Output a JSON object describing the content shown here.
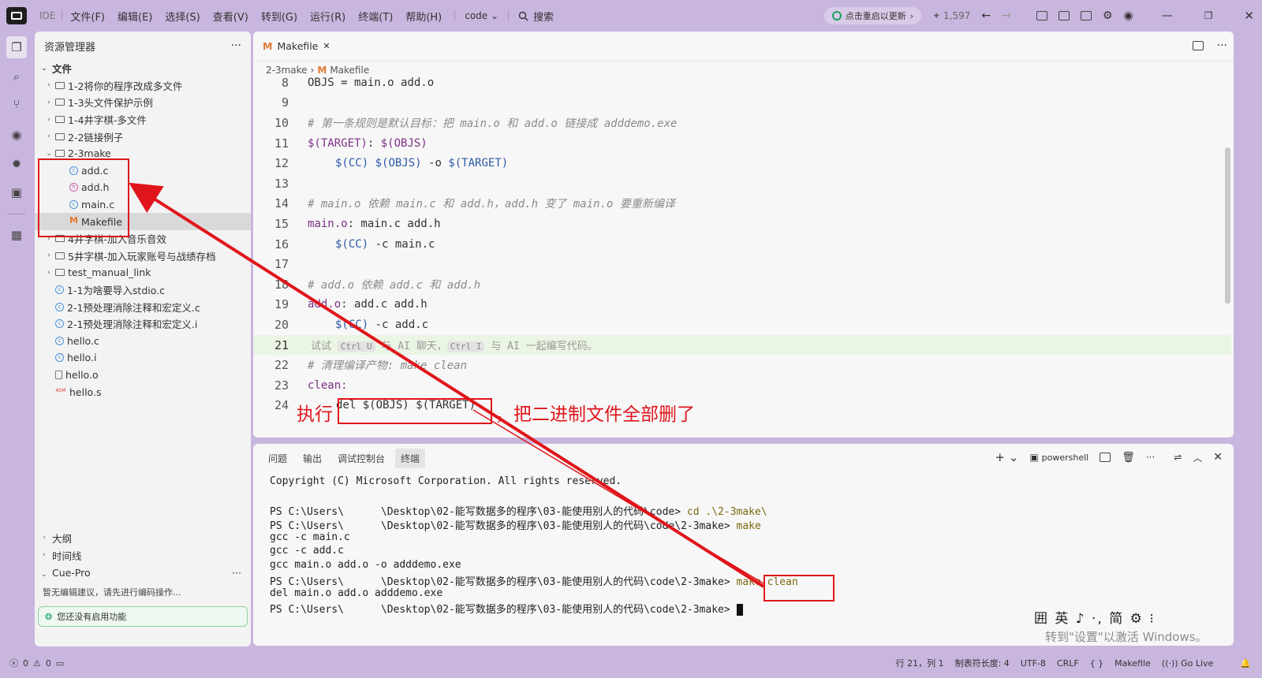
{
  "titlebar": {
    "ide_label": "IDE",
    "menus": [
      "文件(F)",
      "编辑(E)",
      "选择(S)",
      "查看(V)",
      "转到(G)",
      "运行(R)",
      "终端(T)",
      "帮助(H)"
    ],
    "workspace": "code",
    "search": "搜索",
    "update_label": "点击重启以更新",
    "count": "1,597"
  },
  "sidebar": {
    "title": "资源管理器",
    "root": "文件",
    "items": [
      {
        "label": "1-2将你的程序改成多文件",
        "type": "folder",
        "depth": 1
      },
      {
        "label": "1-3头文件保护示例",
        "type": "folder",
        "depth": 1
      },
      {
        "label": "1-4井字棋-多文件",
        "type": "folder",
        "depth": 1
      },
      {
        "label": "2-2链接例子",
        "type": "folder",
        "depth": 1
      },
      {
        "label": "2-3make",
        "type": "folder-open",
        "depth": 1
      },
      {
        "label": "add.c",
        "type": "c",
        "depth": 2
      },
      {
        "label": "add.h",
        "type": "h",
        "depth": 2
      },
      {
        "label": "main.c",
        "type": "c",
        "depth": 2
      },
      {
        "label": "Makefile",
        "type": "make",
        "depth": 2
      },
      {
        "label": "4井字棋-加入音乐音效",
        "type": "folder",
        "depth": 1
      },
      {
        "label": "5井字棋-加入玩家账号与战绩存档",
        "type": "folder",
        "depth": 1
      },
      {
        "label": "test_manual_link",
        "type": "folder",
        "depth": 1
      },
      {
        "label": "1-1为啥要导入stdio.c",
        "type": "c",
        "depth": 1
      },
      {
        "label": "2-1预处理消除注释和宏定义.c",
        "type": "c",
        "depth": 1
      },
      {
        "label": "2-1预处理消除注释和宏定义.i",
        "type": "c",
        "depth": 1
      },
      {
        "label": "hello.c",
        "type": "c",
        "depth": 1
      },
      {
        "label": "hello.i",
        "type": "c",
        "depth": 1
      },
      {
        "label": "hello.o",
        "type": "doc",
        "depth": 1
      },
      {
        "label": "hello.s",
        "type": "asm",
        "depth": 1
      }
    ],
    "outline": "大纲",
    "timeline": "时间线",
    "cuepro": "Cue-Pro",
    "cuepro_hint": "暂无编辑建议，请先进行编码操作...",
    "cuepro_disabled": "您还没有启用功能"
  },
  "editor": {
    "tab": "Makefile",
    "breadcrumb_folder": "2-3make",
    "breadcrumb_file": "Makefile",
    "lines": {
      "l8": "OBJS = main.o add.o",
      "l10": "# 第一条规则是默认目标：把 main.o 和 add.o 链接成 adddemo.exe",
      "l11a": "$(TARGET)",
      "l11b": ": ",
      "l11c": "$(OBJS)",
      "l12a": "$(CC)",
      "l12b": "$(OBJS)",
      "l12c": " -o ",
      "l12d": "$(TARGET)",
      "l14": "# main.o 依赖 main.c 和 add.h，add.h 变了 main.o 要重新编译",
      "l15a": "main.o",
      "l15b": ": main.c add.h",
      "l16a": "$(CC)",
      "l16b": " -c main.c",
      "l18": "# add.o 依赖 add.c 和 add.h",
      "l19a": "add.o",
      "l19b": ": add.c add.h",
      "l20a": "$(CC)",
      "l20b": " -c add.c",
      "l21a": "试试 ",
      "l21k1": "Ctrl U",
      "l21b": " 与 AI 聊天，",
      "l21k2": "Ctrl I",
      "l21c": " 与 AI 一起编写代码。",
      "l22": "# 清理编译产物: make clean",
      "l23": "clean:",
      "l24": "del $(OBJS) $(TARGET)"
    },
    "line_numbers": [
      "8",
      "9",
      "10",
      "11",
      "12",
      "13",
      "14",
      "15",
      "16",
      "17",
      "18",
      "19",
      "20",
      "21",
      "22",
      "23",
      "24"
    ]
  },
  "panel": {
    "tabs": [
      "问题",
      "输出",
      "调试控制台",
      "终端"
    ],
    "shell": "powershell",
    "terminal": [
      "Copyright (C) Microsoft Corporation. All rights reserved.",
      "",
      "PS C:\\Users\\      \\Desktop\\02-能写数据多的程序\\03-能使用别人的代码\\code> ",
      "PS C:\\Users\\      \\Desktop\\02-能写数据多的程序\\03-能使用别人的代码\\code\\2-3make> ",
      "gcc -c main.c",
      "gcc -c add.c",
      "gcc main.o add.o -o adddemo.exe",
      "PS C:\\Users\\      \\Desktop\\02-能写数据多的程序\\03-能使用别人的代码\\code\\2-3make> ",
      "del main.o add.o adddemo.exe",
      "PS C:\\Users\\      \\Desktop\\02-能写数据多的程序\\03-能使用别人的代码\\code\\2-3make> "
    ],
    "cmd1": "cd .\\2-3make\\",
    "cmd2": "make",
    "cmd3": "make clean"
  },
  "annotation": {
    "prefix": "执行",
    "suffix": "，把二进制文件全部删了"
  },
  "overlay": {
    "ime": "囲 英 ♪ ·, 简 ⚙ ⁝",
    "activate": "转到\"设置\"以激活 Windows。"
  },
  "statusbar": {
    "errors": "0",
    "warnings": "0",
    "position": "行 21，列 1",
    "tabsize": "制表符长度: 4",
    "encoding": "UTF-8",
    "eol": "CRLF",
    "braces": "{ }",
    "language": "Makefile",
    "golive": "Go Live"
  },
  "colors": {
    "accent": "#c9b6de",
    "annotation_red": "#e0151b"
  }
}
